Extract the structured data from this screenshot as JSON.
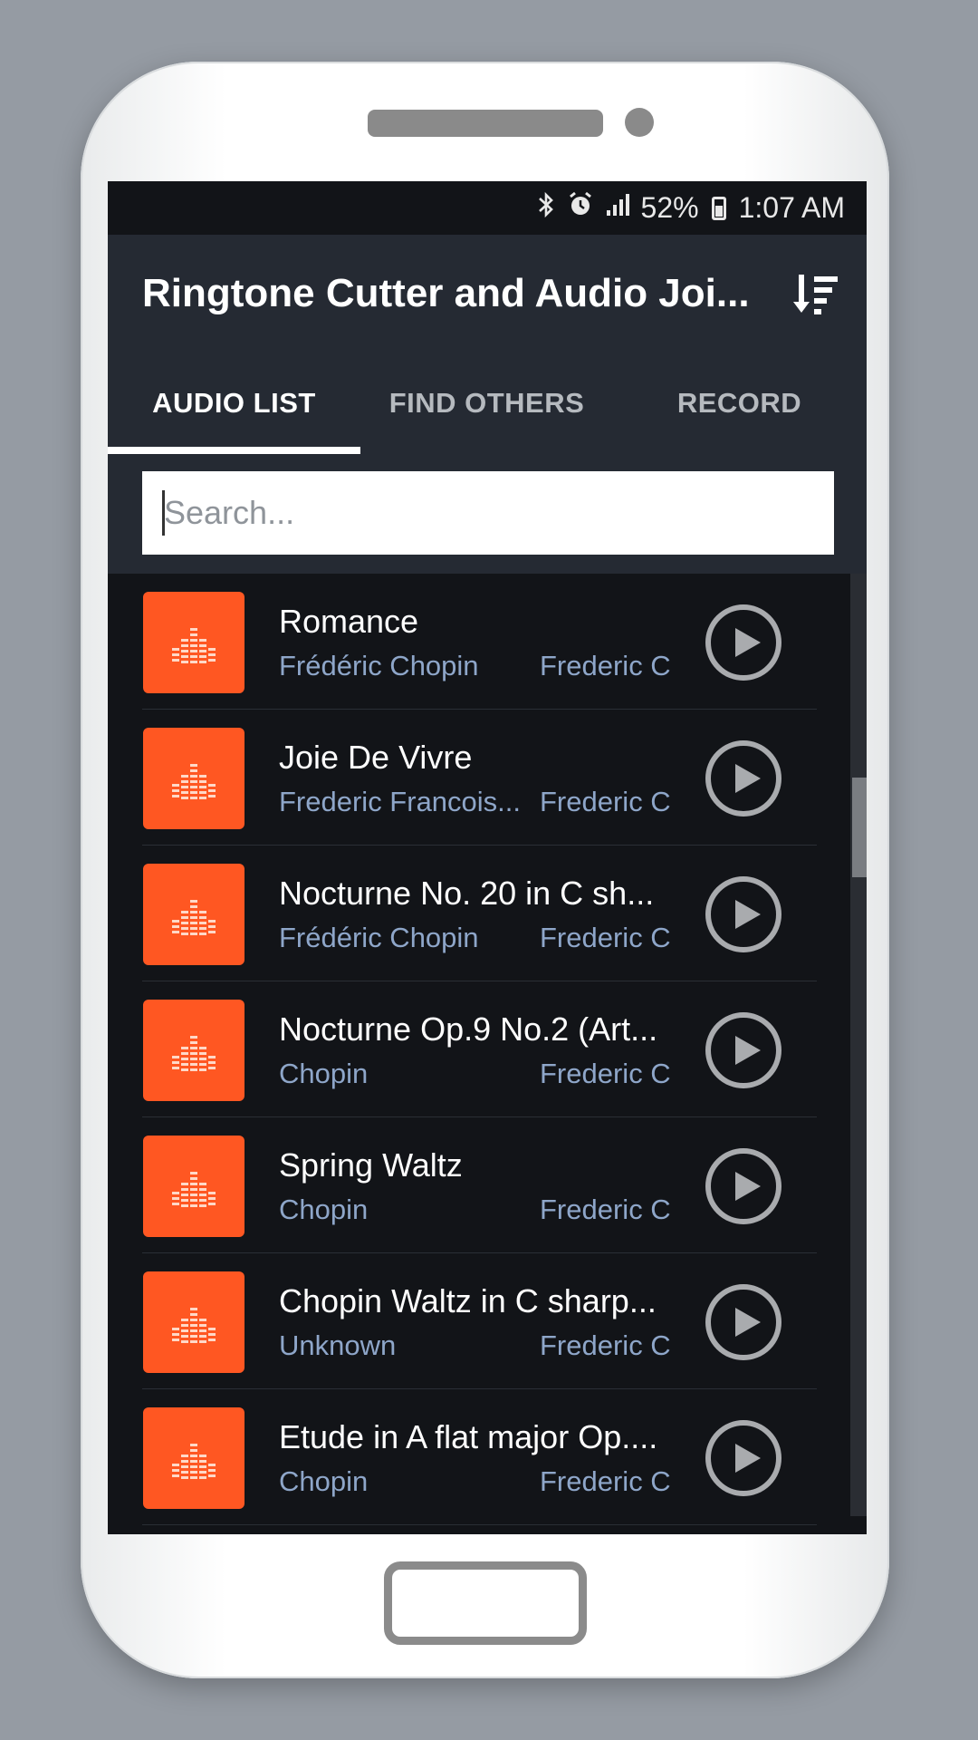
{
  "status_bar": {
    "icons": [
      "bluetooth-icon",
      "alarm-icon",
      "signal-icon",
      "battery-icon"
    ],
    "battery_percent": "52%",
    "time": "1:07 AM"
  },
  "app_bar": {
    "title": "Ringtone Cutter and Audio Joi...",
    "sort_icon": "sort-icon"
  },
  "tabs": [
    {
      "label": "AUDIO LIST",
      "active": true
    },
    {
      "label": "FIND OTHERS",
      "active": false
    },
    {
      "label": "RECORD",
      "active": false
    }
  ],
  "search": {
    "placeholder": "Search..."
  },
  "colors": {
    "accent": "#ff5722",
    "appbar": "#252a33",
    "background": "#121418",
    "subtext": "#8ea6c9"
  },
  "tracks": [
    {
      "title": "Romance",
      "artist": "Frédéric Chopin",
      "album": "Frederic C"
    },
    {
      "title": "Joie De Vivre",
      "artist": "Frederic Francois...",
      "album": "Frederic C"
    },
    {
      "title": "Nocturne No. 20 in C sh...",
      "artist": "Frédéric Chopin",
      "album": "Frederic C"
    },
    {
      "title": "Nocturne Op.9 No.2 (Art...",
      "artist": "Chopin",
      "album": "Frederic C"
    },
    {
      "title": "Spring Waltz",
      "artist": "Chopin",
      "album": "Frederic C"
    },
    {
      "title": "Chopin Waltz in C sharp...",
      "artist": "Unknown",
      "album": "Frederic C"
    },
    {
      "title": "Etude in A flat major Op....",
      "artist": "Chopin",
      "album": "Frederic C"
    }
  ]
}
